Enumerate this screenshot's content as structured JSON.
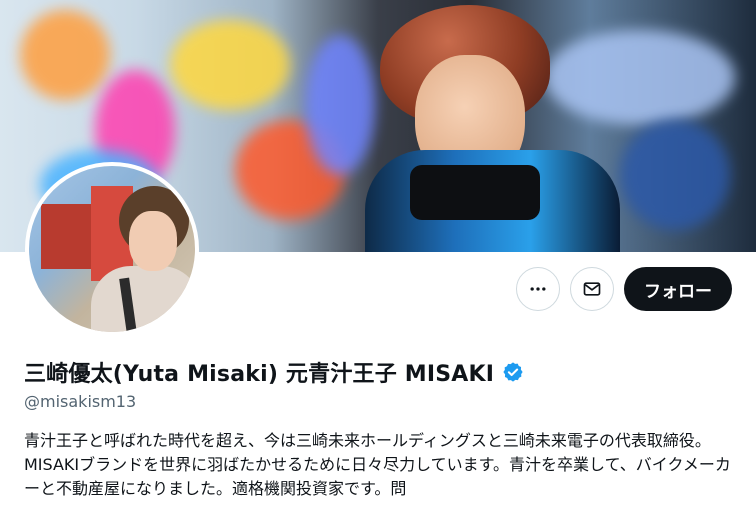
{
  "profile": {
    "display_name": "三崎優太(Yuta Misaki) 元青汁王子 MISAKI",
    "handle": "@misakism13",
    "bio": "青汁王子と呼ばれた時代を超え、今は三崎未来ホールディングスと三崎未来電子の代表取締役。MISAKIブランドを世界に羽ばたかせるために日々尽力しています。青汁を卒業して、バイクメーカーと不動産屋になりました。適格機関投資家です。問",
    "verified": true
  },
  "actions": {
    "more_icon": "more-horizontal-icon",
    "message_icon": "envelope-icon",
    "follow_label": "フォロー"
  },
  "colors": {
    "follow_bg": "#0f1419",
    "verified_blue": "#1d9bf0",
    "muted_text": "#536471",
    "border": "#cfd9de"
  }
}
